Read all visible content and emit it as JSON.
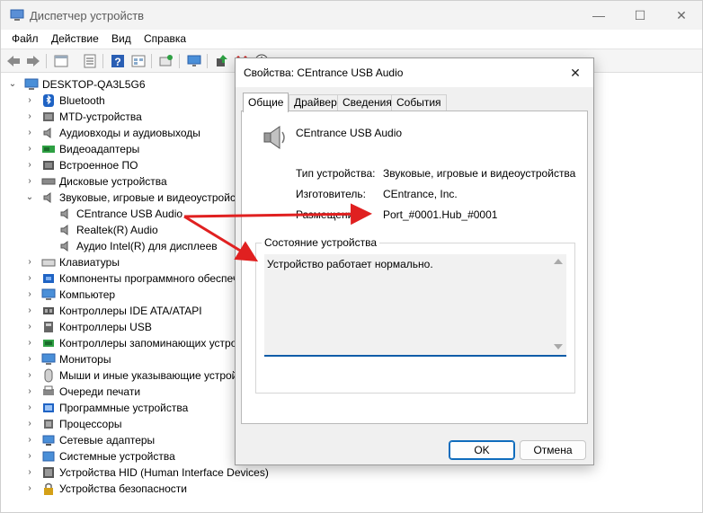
{
  "window": {
    "title": "Диспетчер устройств",
    "minimize": "—",
    "maximize": "☐",
    "close": "✕"
  },
  "menu": [
    "Файл",
    "Действие",
    "Вид",
    "Справка"
  ],
  "toolbar": {
    "icons": [
      "back-arrow-icon",
      "forward-arrow-icon",
      "properties-icon",
      "list-icon",
      "help-icon",
      "grid-view-icon",
      "scan-hardware-icon",
      "monitor-icon",
      "update-driver-icon",
      "uninstall-icon",
      "download-icon"
    ]
  },
  "tree": {
    "root": "DESKTOP-QA3L5G6",
    "items": [
      {
        "label": "Bluetooth",
        "icon": "bluetooth-icon",
        "expanded": false
      },
      {
        "label": "MTD-устройства",
        "icon": "mtd-device-icon",
        "expanded": false
      },
      {
        "label": "Аудиовходы и аудиовыходы",
        "icon": "audio-io-icon",
        "expanded": false
      },
      {
        "label": "Видеоадаптеры",
        "icon": "display-adapter-icon",
        "expanded": false
      },
      {
        "label": "Встроенное ПО",
        "icon": "firmware-icon",
        "expanded": false
      },
      {
        "label": "Дисковые устройства",
        "icon": "disk-drive-icon",
        "expanded": false
      },
      {
        "label": "Звуковые, игровые и видеоустройства",
        "icon": "sound-icon",
        "expanded": true,
        "children": [
          "CEntrance USB Audio",
          "Realtek(R) Audio",
          "Аудио Intel(R) для дисплеев"
        ]
      },
      {
        "label": "Клавиатуры",
        "icon": "keyboard-icon",
        "expanded": false
      },
      {
        "label": "Компоненты программного обеспечения",
        "icon": "software-component-icon",
        "expanded": false
      },
      {
        "label": "Компьютер",
        "icon": "computer-icon",
        "expanded": false
      },
      {
        "label": "Контроллеры IDE ATA/ATAPI",
        "icon": "ide-controller-icon",
        "expanded": false
      },
      {
        "label": "Контроллеры USB",
        "icon": "usb-controller-icon",
        "expanded": false
      },
      {
        "label": "Контроллеры запоминающих устройств",
        "icon": "storage-controller-icon",
        "expanded": false
      },
      {
        "label": "Мониторы",
        "icon": "monitor-icon",
        "expanded": false
      },
      {
        "label": "Мыши и иные указывающие устройства",
        "icon": "mouse-icon",
        "expanded": false
      },
      {
        "label": "Очереди печати",
        "icon": "print-queue-icon",
        "expanded": false
      },
      {
        "label": "Программные устройства",
        "icon": "software-device-icon",
        "expanded": false
      },
      {
        "label": "Процессоры",
        "icon": "processor-icon",
        "expanded": false
      },
      {
        "label": "Сетевые адаптеры",
        "icon": "network-adapter-icon",
        "expanded": false
      },
      {
        "label": "Системные устройства",
        "icon": "system-device-icon",
        "expanded": false
      },
      {
        "label": "Устройства HID (Human Interface Devices)",
        "icon": "hid-icon",
        "expanded": false
      },
      {
        "label": "Устройства безопасности",
        "icon": "security-device-icon",
        "expanded": false
      }
    ]
  },
  "dialog": {
    "title": "Свойства: CEntrance USB Audio",
    "close": "✕",
    "tabs": [
      "Общие",
      "Драйвер",
      "Сведения",
      "События"
    ],
    "active_tab": 0,
    "device_name": "CEntrance USB Audio",
    "properties": [
      {
        "label": "Тип устройства:",
        "value": "Звуковые, игровые и видеоустройства"
      },
      {
        "label": "Изготовитель:",
        "value": "CEntrance, Inc."
      },
      {
        "label": "Размещение:",
        "value": "Port_#0001.Hub_#0001"
      }
    ],
    "status_group_label": "Состояние устройства",
    "status_text": "Устройство работает нормально.",
    "ok_label": "OK",
    "cancel_label": "Отмена"
  },
  "colors": {
    "annotation_arrow": "#e02020",
    "focus_blue": "#0f5ca8"
  }
}
